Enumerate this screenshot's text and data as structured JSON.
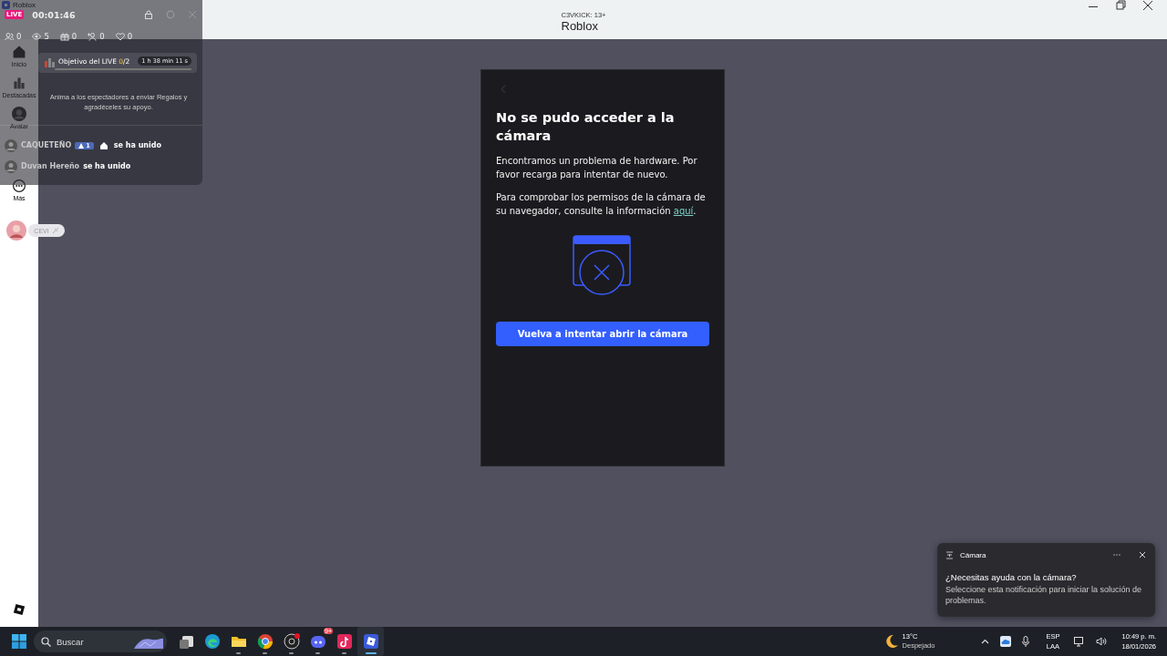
{
  "window": {
    "app_label": "Roblox",
    "subtitle": "C3VKICK: 13+",
    "title": "Roblox"
  },
  "sidebar": {
    "items": [
      {
        "kind": "home",
        "label": "Inicio"
      },
      {
        "kind": "charts",
        "label": "Destacadas"
      },
      {
        "kind": "avatar",
        "label": "Avatar"
      },
      {
        "kind": "more",
        "label": "Más"
      }
    ],
    "user": "CEVI"
  },
  "dialog": {
    "title": "No se pudo acceder a la cámara",
    "message": "Encontramos un problema de hardware. Por favor recarga para intentar de nuevo.",
    "permissions_text": "Para comprobar los permisos de la cámara de su navegador, consulte la información ",
    "link": "aquí",
    "after_link": ".",
    "button": "Vuelva a intentar abrir la cámara"
  },
  "live_overlay": {
    "badge": "LIVE",
    "timer": "00:01:46",
    "stats": [
      {
        "kind": "viewers",
        "value": "0"
      },
      {
        "kind": "views",
        "value": "5"
      },
      {
        "kind": "gifts",
        "value": "0"
      },
      {
        "kind": "followers",
        "value": "0"
      },
      {
        "kind": "likes",
        "value": "0"
      }
    ],
    "goal": {
      "label": "Objetivo del LIVE",
      "current": "0",
      "total": "/2",
      "remaining": "1 h 38 min 11 s",
      "level": 0
    },
    "prompt": "Anima a los espectadores a enviar Regalos y agradéceles su apoyo.",
    "events": [
      {
        "user": "CAQUETEÑO",
        "badge": "1",
        "action": "se ha unido"
      },
      {
        "user": "Duvan Hereño",
        "action": "se ha unido"
      }
    ]
  },
  "notification": {
    "app": "Cámara",
    "title": "¿Necesitas ayuda con la cámara?",
    "body": "Seleccione esta notificación para iniciar la solución de problemas."
  },
  "taskbar": {
    "search_placeholder": "Buscar",
    "apps": [
      {
        "kind": "task-view",
        "running": false,
        "selected": false
      },
      {
        "kind": "edge",
        "running": false,
        "selected": false
      },
      {
        "kind": "explorer",
        "running": true,
        "selected": false
      },
      {
        "kind": "chrome",
        "running": true,
        "selected": false
      },
      {
        "kind": "obs",
        "running": true,
        "selected": false
      },
      {
        "kind": "discord",
        "running": true,
        "selected": false,
        "badge": "9+"
      },
      {
        "kind": "tiktok",
        "running": true,
        "selected": false
      },
      {
        "kind": "roblox",
        "running": true,
        "selected": true
      }
    ],
    "weather": {
      "temp": "13°C",
      "condition": "Despejado"
    },
    "language": [
      "ESP",
      "LAA"
    ],
    "time": "10:49 p. m.",
    "date": "18/01/2026"
  }
}
